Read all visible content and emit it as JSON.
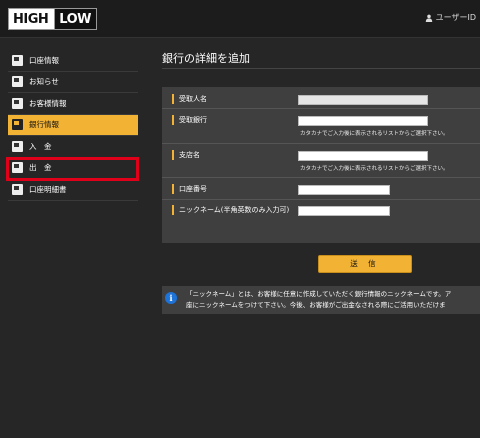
{
  "header": {
    "logo_high": "HIGH",
    "logo_low": "LOW",
    "user_label": "ユーザーID"
  },
  "sidebar": {
    "items": [
      {
        "label": "口座情報",
        "icon": "account-icon"
      },
      {
        "label": "お知らせ",
        "icon": "news-icon"
      },
      {
        "label": "お客様情報",
        "icon": "customer-icon"
      },
      {
        "label": "銀行情報",
        "icon": "bank-icon",
        "active": true
      },
      {
        "label": "入　金",
        "icon": "deposit-icon"
      },
      {
        "label": "出　金",
        "icon": "withdraw-icon"
      },
      {
        "label": "口座明細書",
        "icon": "statement-icon"
      }
    ]
  },
  "main": {
    "title": "銀行の詳細を追加",
    "form": {
      "recipient_label": "受取人名",
      "recipient_value": "",
      "bank_label": "受取銀行",
      "bank_hint": "カタカナでご入力後に表示されるリストからご選択下さい。",
      "branch_label": "支店名",
      "branch_hint": "カタカナでご入力後に表示されるリストからご選択下さい。",
      "account_label": "口座番号",
      "nickname_label": "ニックネーム(半角英数のみ入力可)"
    },
    "submit_label": "送 信",
    "notice_line1": "「ニックネーム」とは、お客様に任意に作成していただく銀行情報のニックネームです。ア",
    "notice_line2": "座にニックネームをつけて下さい。今後、お客様がご出金なされる際にご活用いただけま"
  },
  "colors": {
    "accent": "#f2b233",
    "highlight": "#e0001a",
    "info": "#1e73d8"
  }
}
